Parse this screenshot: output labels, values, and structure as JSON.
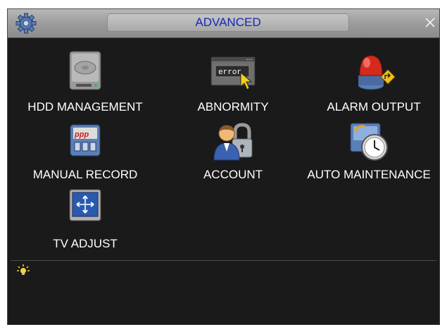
{
  "window": {
    "title": "ADVANCED"
  },
  "menu": {
    "items": [
      {
        "label": "HDD MANAGEMENT",
        "icon": "hdd-icon"
      },
      {
        "label": "ABNORMITY",
        "icon": "error-monitor-icon",
        "icon_text": "error"
      },
      {
        "label": "ALARM OUTPUT",
        "icon": "alarm-light-icon"
      },
      {
        "label": "MANUAL RECORD",
        "icon": "record-panel-icon"
      },
      {
        "label": "ACCOUNT",
        "icon": "user-lock-icon"
      },
      {
        "label": "AUTO MAINTENANCE",
        "icon": "clock-maintenance-icon"
      },
      {
        "label": "TV ADJUST",
        "icon": "tv-screen-icon"
      }
    ]
  },
  "hint": {
    "icon": "lightbulb-icon"
  },
  "colors": {
    "title_text": "#1428b8",
    "panel_bg": "#1a1a1a",
    "label_text": "#ffffff"
  }
}
